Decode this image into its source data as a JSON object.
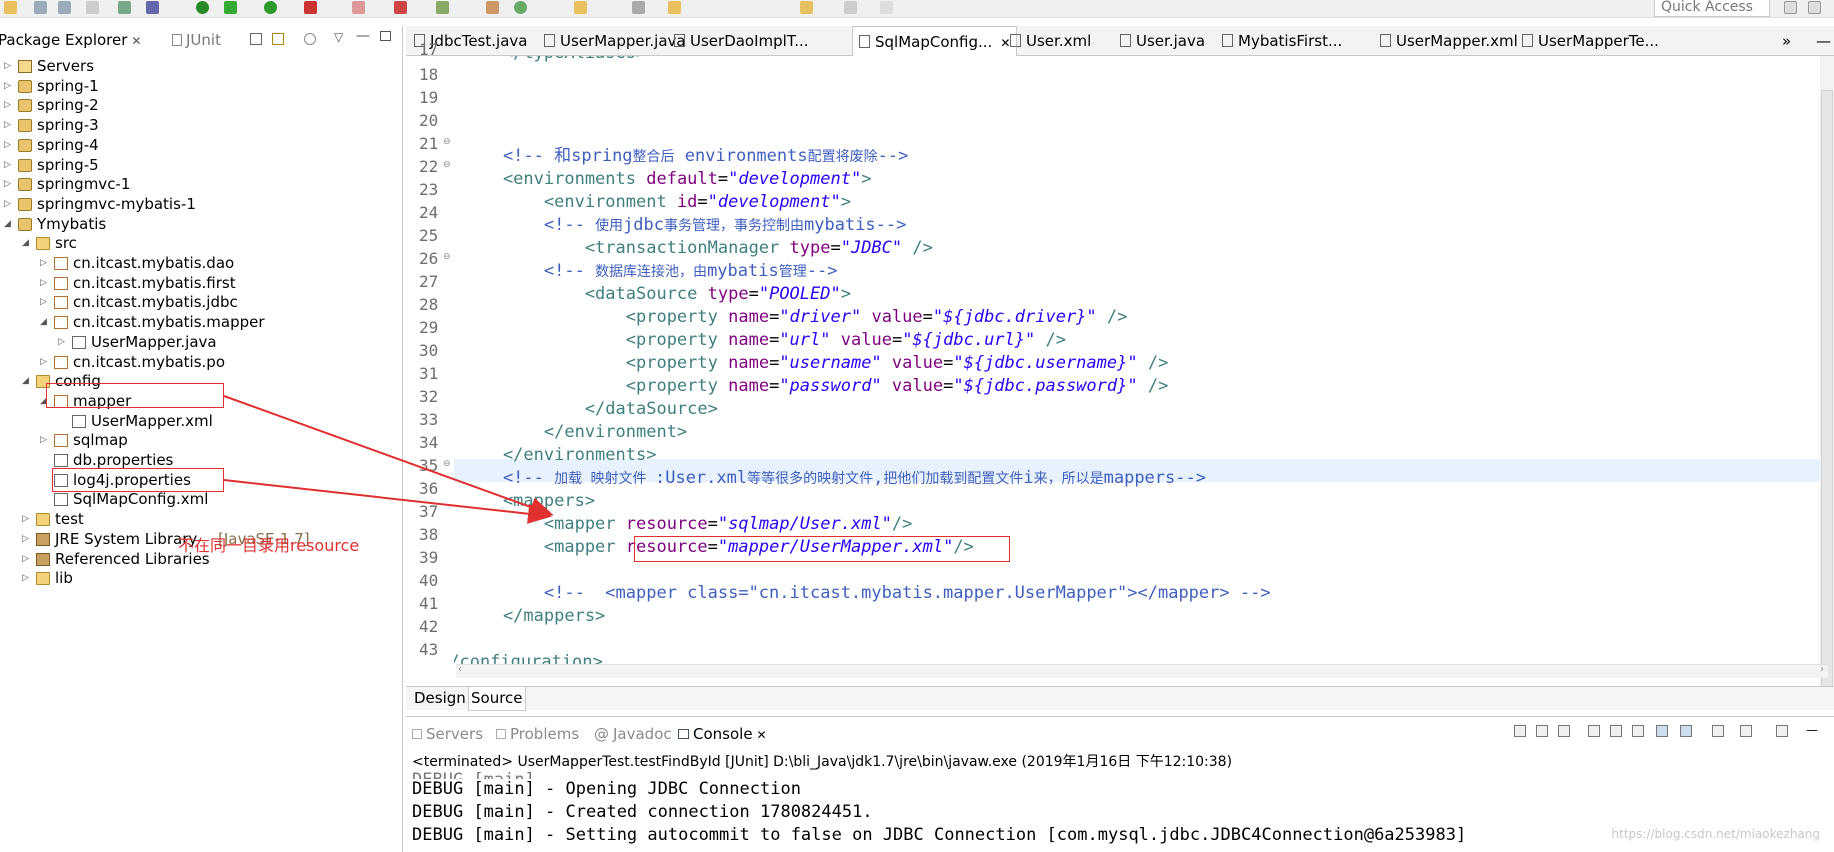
{
  "toolbar": {
    "quick_access": "Quick Access"
  },
  "left_panel": {
    "tabs": [
      {
        "label": "Package Explorer",
        "close": "✕"
      },
      {
        "label": "JUnit"
      }
    ],
    "tree": [
      {
        "label": "Servers",
        "icon": "server-folder-icon"
      },
      {
        "label": "spring-1",
        "icon": "project-icon"
      },
      {
        "label": "spring-2",
        "icon": "project-icon"
      },
      {
        "label": "spring-3",
        "icon": "project-icon"
      },
      {
        "label": "spring-4",
        "icon": "project-icon"
      },
      {
        "label": "spring-5",
        "icon": "project-icon"
      },
      {
        "label": "springmvc-1",
        "icon": "project-icon"
      },
      {
        "label": "springmvc-mybatis-1",
        "icon": "project-icon"
      },
      {
        "label": "Ymybatis",
        "icon": "project-icon"
      },
      {
        "label": "src",
        "icon": "source-folder-icon"
      },
      {
        "label": "cn.itcast.mybatis.dao",
        "icon": "package-icon"
      },
      {
        "label": "cn.itcast.mybatis.first",
        "icon": "package-icon"
      },
      {
        "label": "cn.itcast.mybatis.jdbc",
        "icon": "package-icon"
      },
      {
        "label": "cn.itcast.mybatis.mapper",
        "icon": "package-icon"
      },
      {
        "label": "UserMapper.java",
        "icon": "java-file-icon"
      },
      {
        "label": "cn.itcast.mybatis.po",
        "icon": "package-icon"
      },
      {
        "label": "config",
        "icon": "source-folder-icon"
      },
      {
        "label": "mapper",
        "icon": "package-icon"
      },
      {
        "label": "UserMapper.xml",
        "icon": "xml-file-icon"
      },
      {
        "label": "sqlmap",
        "icon": "package-icon"
      },
      {
        "label": "db.properties",
        "icon": "properties-file-icon"
      },
      {
        "label": "log4j.properties",
        "icon": "properties-file-icon"
      },
      {
        "label": "SqlMapConfig.xml",
        "icon": "xml-file-icon"
      },
      {
        "label": "test",
        "icon": "source-folder-icon"
      },
      {
        "label": "JRE System Library",
        "extra": "[JavaSE-1.7]",
        "icon": "library-icon"
      },
      {
        "label": "Referenced Libraries",
        "icon": "library-icon"
      },
      {
        "label": "lib",
        "icon": "folder-icon"
      }
    ],
    "annotation": "不在同一目录用resource"
  },
  "editor": {
    "tabs": [
      {
        "label": "JdbcTest.java"
      },
      {
        "label": "UserMapper.java"
      },
      {
        "label": "UserDaoImplT..."
      },
      {
        "label": "SqlMapConfig...",
        "close": "✕"
      },
      {
        "label": "User.xml"
      },
      {
        "label": "User.java"
      },
      {
        "label": "MybatisFirst..."
      },
      {
        "label": "UserMapper.xml"
      },
      {
        "label": "UserMapperTe..."
      }
    ],
    "overflow": "»",
    "line_numbers": [
      "18",
      "19",
      "20",
      "21",
      "22",
      "23",
      "24",
      "25",
      "26",
      "27",
      "28",
      "29",
      "30",
      "31",
      "32",
      "33",
      "34",
      "35",
      "36",
      "37",
      "38",
      "39",
      "40",
      "41",
      "42",
      "43"
    ],
    "lines": {
      "l17": "    </typeAliases>",
      "l20_a": "    <!-- 和",
      "l20_b": "spring",
      "l20_c": "整合后",
      "l20_d": " environments",
      "l20_e": "配置将废除",
      "l20_f": "-->",
      "l21_tag": "    <environments ",
      "l21_attr": "default",
      "l21_val": "\"development\"",
      "l21_end": ">",
      "l22_tag": "        <environment ",
      "l22_attr": "id",
      "l22_val": "\"development\"",
      "l22_end": ">",
      "l23_a": "        <!-- ",
      "l23_b": "使用",
      "l23_c": "jdbc",
      "l23_d": "事务管理，事务控制由",
      "l23_e": "mybatis",
      "l23_f": "-->",
      "l24_tag": "            <transactionManager ",
      "l24_attr": "type",
      "l24_val": "\"JDBC\"",
      "l24_end": " />",
      "l25_a": "        <!-- ",
      "l25_b": "数据库连接池，由",
      "l25_c": "mybatis",
      "l25_d": "管理",
      "l25_e": "-->",
      "l26_tag": "            <dataSource ",
      "l26_attr": "type",
      "l26_val": "\"POOLED\"",
      "l26_end": ">",
      "props": [
        {
          "name": "\"driver\"",
          "value": "\"${jdbc.driver}\""
        },
        {
          "name": "\"url\"",
          "value": "\"${jdbc.url}\""
        },
        {
          "name": "\"username\"",
          "value": "\"${jdbc.username}\""
        },
        {
          "name": "\"password\"",
          "value": "\"${jdbc.password}\""
        }
      ],
      "prop_tag": "                <property ",
      "prop_name": "name",
      "prop_value": "value",
      "prop_end": " />",
      "l31": "            </dataSource>",
      "l32": "        </environment>",
      "l33": "    </environments>",
      "l34_a": "    <!-- ",
      "l34_b": "加载 映射文件 ",
      "l34_c": ":User.xml",
      "l34_d": "等等很多的映射文件",
      "l34_e": ",",
      "l34_f": "把他们加载到配置文件",
      "l34_g": "i",
      "l34_h": "来，所以是",
      "l34_i": "mappers",
      "l34_j": "-->",
      "l35": "    <mappers>",
      "l36_tag": "        <mapper ",
      "l36_attr": "resource",
      "l36_val": "\"sqlmap/User.xml\"",
      "l36_end": "/>",
      "l37_tag": "        <mapper ",
      "l37_attr": "resource",
      "l37_val": "\"mapper/UserMapper.xml\"",
      "l37_end": "/>",
      "l39": "        <!--  <mapper class=\"cn.itcast.mybatis.mapper.UserMapper\"></mapper> -->",
      "l40": "    </mappers>",
      "l42": "</configuration>"
    },
    "bottom_tabs": [
      "Design",
      "Source"
    ]
  },
  "console": {
    "tabs": [
      "Servers",
      "Problems",
      "Javadoc",
      "Console"
    ],
    "terminated": "<terminated> UserMapperTest.testFindById [JUnit] D:\\bli_Java\\jdk1.7\\jre\\bin\\javaw.exe (2019年1月16日 下午12:10:38)",
    "lines": [
      "DEBUG [main] - Opening JDBC Connection",
      "DEBUG [main] - Created connection 1780824451.",
      "DEBUG [main] - Setting autocommit to false on JDBC Connection [com.mysql.jdbc.JDBC4Connection@6a253983]"
    ],
    "watermark": "https://blog.csdn.net/miaokezhang"
  },
  "colors": {
    "comment": "#3f5fbf",
    "tag": "#3f7f7f",
    "attr": "#7f007f",
    "value": "#2a00ff",
    "annotation": "#e03030"
  }
}
